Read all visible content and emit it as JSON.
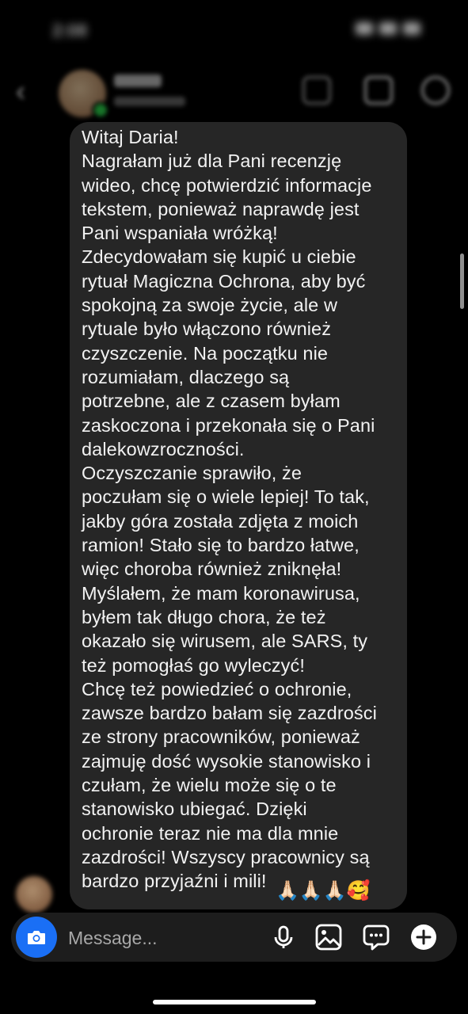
{
  "message": {
    "lines": [
      "Witaj Daria!",
      "Nagrałam już dla Pani recenzję",
      "wideo, chcę potwierdzić informacje",
      "tekstem, ponieważ naprawdę jest",
      "Pani wspaniała wróżką!",
      "Zdecydowałam się kupić u ciebie",
      "rytuał Magiczna Ochrona, aby być",
      "spokojną za swoje życie, ale w",
      "rytuale było włączono również",
      "czyszczenie. Na początku nie",
      "rozumiałam, dlaczego są",
      "potrzebne, ale z czasem byłam",
      "zaskoczona i przekonała się o Pani",
      "dalekowzroczności.",
      "Oczyszczanie sprawiło, że",
      "poczułam się o wiele lepiej! To tak,",
      "jakby góra została zdjęta z moich",
      "ramion! Stało się to bardzo łatwe,",
      "więc choroba również zniknęła!",
      "Myślałem, że mam koronawirusa,",
      "byłem tak długo chora, że też",
      "okazało się wirusem, ale SARS, ty",
      "też pomogłaś go wyleczyć!",
      "Chcę też powiedzieć o ochronie,",
      "zawsze bardzo bałam się zazdrości",
      "ze strony pracowników, ponieważ",
      "zajmuję dość wysokie stanowisko i",
      "czułam, że wielu może się o te",
      "stanowisko ubiegać. Dzięki",
      "ochronie teraz nie ma dla mnie",
      "zazdrości! Wszyscy pracownicy są",
      "bardzo przyjaźni i mili!"
    ],
    "emojis": "🙏🏻🙏🏻🙏🏻🥰"
  },
  "composer": {
    "placeholder": "Message..."
  },
  "icons": {
    "camera": "camera-icon",
    "mic": "microphone-icon",
    "gallery": "image-gallery-icon",
    "sticker": "chat-bubble-icon",
    "add": "plus-circle-icon"
  },
  "colors": {
    "camera_button": "#1a6ff5",
    "bubble": "#262626",
    "composer": "#1d1d1d"
  }
}
